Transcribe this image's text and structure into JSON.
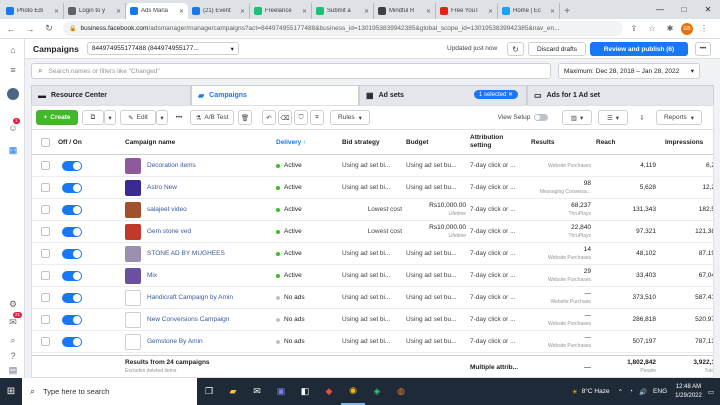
{
  "browser": {
    "tabs": [
      {
        "label": "Photo Edi",
        "color": "#1877f2"
      },
      {
        "label": "Login to y",
        "color": "#5f6368"
      },
      {
        "label": "Ads Mana",
        "color": "#1877f2"
      },
      {
        "label": "(21) Event",
        "color": "#1877f2"
      },
      {
        "label": "Freelance",
        "color": "#1dbf73"
      },
      {
        "label": "Submit a",
        "color": "#1dbf73"
      },
      {
        "label": "Mindful R",
        "color": "#3c4043"
      },
      {
        "label": "Free YouT",
        "color": "#e62117"
      },
      {
        "label": "Home | Ec",
        "color": "#1da1f2"
      }
    ],
    "new_tab": "+",
    "url_domain": "business.facebook.com",
    "url_path": "/adsmanager/manage/campaigns?act=844974955177488&business_id=1301953839942385&global_scope_id=1301953839942385&nav_en...",
    "profile_initials": "GB"
  },
  "rail": {
    "notif_count": "1",
    "badge_count": "21"
  },
  "header": {
    "title": "Campaigns",
    "account": "844974955177488 (844974955177...",
    "updated": "Updated just now",
    "discard": "Discard drafts",
    "publish": "Review and publish (6)"
  },
  "search": {
    "placeholder": "Search names or filters like \"Changed\"",
    "date_range": "Maximum: Dec 28, 2018 – Jan 28, 2022"
  },
  "levels": {
    "resource": "Resource Center",
    "campaigns": "Campaigns",
    "adsets": "Ad sets",
    "selected": "1 selected",
    "ads": "Ads for 1 Ad set"
  },
  "toolbar": {
    "create": "Create",
    "edit": "Edit",
    "ab_test": "A/B Test",
    "rules": "Rules",
    "view_setup": "View Setup",
    "reports": "Reports"
  },
  "table": {
    "headers": {
      "onoff": "Off / On",
      "name": "Campaign name",
      "delivery": "Delivery ↑",
      "bid": "Bid strategy",
      "budget": "Budget",
      "attribution": "Attribution setting",
      "results": "Results",
      "reach": "Reach",
      "impressions": "Impressions"
    },
    "rows": [
      {
        "name": "Decoration items",
        "thumb": "#8e5a9b",
        "delivery": "Active",
        "dot": "#42b72a",
        "bid": "Using ad set bi...",
        "budget": "Using ad set bu...",
        "attribution": "7-day click or ...",
        "results": "",
        "results_label": "Website Purchases",
        "reach": "4,119",
        "impressions": "6,2"
      },
      {
        "name": "Astro New",
        "thumb": "#3b2a8f",
        "delivery": "Active",
        "dot": "#42b72a",
        "bid": "Using ad set bi...",
        "budget": "Using ad set bu...",
        "attribution": "7-day click or ...",
        "results": "98",
        "results_label": "Messaging Conversa...",
        "reach": "5,628",
        "impressions": "12,2"
      },
      {
        "name": "salajeet video",
        "thumb": "#a0522d",
        "delivery": "Active",
        "dot": "#42b72a",
        "bid": "Lowest cost",
        "budget": "Rs10,000.00",
        "budget_label": "Lifetime",
        "attribution": "7-day click or ...",
        "results": "68,237",
        "results_label": "ThruPlays",
        "reach": "131,343",
        "impressions": "182,5"
      },
      {
        "name": "Gem stone ved",
        "thumb": "#c0392b",
        "delivery": "Active",
        "dot": "#42b72a",
        "bid": "Lowest cost",
        "budget": "Rs10,000.00",
        "budget_label": "Lifetime",
        "attribution": "7-day click or ...",
        "results": "22,840",
        "results_label": "ThruPlays",
        "reach": "97,321",
        "impressions": "121,38"
      },
      {
        "name": "STONE AD BY MUGHEES",
        "thumb": "#9b8fb0",
        "delivery": "Active",
        "dot": "#42b72a",
        "bid": "Using ad set bi...",
        "budget": "Using ad set bu...",
        "attribution": "7-day click or ...",
        "results": "14",
        "results_label": "Website Purchases",
        "reach": "48,102",
        "impressions": "87,19"
      },
      {
        "name": "Mix",
        "thumb": "#6c4fa3",
        "delivery": "Active",
        "dot": "#42b72a",
        "bid": "Using ad set bi...",
        "budget": "Using ad set bu...",
        "attribution": "7-day click or ...",
        "results": "29",
        "results_label": "Website Purchases",
        "reach": "33,403",
        "impressions": "67,04"
      },
      {
        "name": "Handicraft Campaign by Amin",
        "thumb": "",
        "delivery": "No ads",
        "dot": "#bec3c9",
        "bid": "Using ad set bi...",
        "budget": "Using ad set bu...",
        "attribution": "7-day click or ...",
        "results": "—",
        "results_label": "Website Purchase",
        "reach": "373,510",
        "impressions": "587,41"
      },
      {
        "name": "New Conversions Campaign",
        "thumb": "",
        "delivery": "No ads",
        "dot": "#bec3c9",
        "bid": "Using ad set bi...",
        "budget": "Using ad set bu...",
        "attribution": "7-day click or ...",
        "results": "—",
        "results_label": "Website Purchases",
        "reach": "286,818",
        "impressions": "520,97"
      },
      {
        "name": "Gemstone By Amin",
        "thumb": "",
        "delivery": "No ads",
        "dot": "#bec3c9",
        "bid": "Using ad set bi...",
        "budget": "Using ad set bu...",
        "attribution": "7-day click or ...",
        "results": "—",
        "results_label": "Website Purchases",
        "reach": "507,197",
        "impressions": "787,13"
      }
    ],
    "footer": {
      "title": "Results from 24 campaigns",
      "note": "Excludes deleted items",
      "attribution": "Multiple attrib...",
      "results": "—",
      "reach": "1,802,842",
      "reach_label": "People",
      "impressions": "3,922,1",
      "impressions_label": "Total"
    }
  },
  "taskbar": {
    "search_placeholder": "Type here to search",
    "weather": "8°C  Haze",
    "lang": "ENG",
    "time": "12:48 AM",
    "date": "1/29/2022"
  }
}
